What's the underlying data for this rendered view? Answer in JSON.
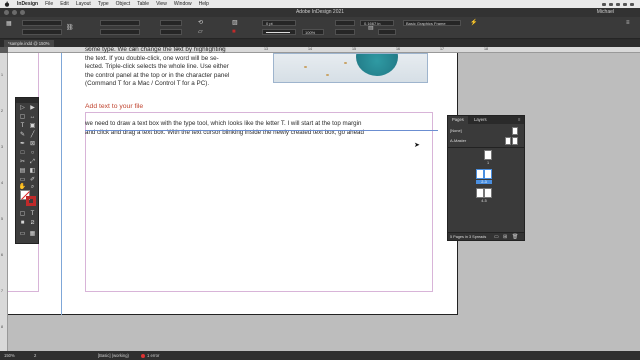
{
  "menubar": {
    "app": "InDesign",
    "items": [
      "File",
      "Edit",
      "Layout",
      "Type",
      "Object",
      "Table",
      "View",
      "Window",
      "Help"
    ]
  },
  "window": {
    "title": "Adobe InDesign 2021",
    "user": "Michael"
  },
  "control": {
    "font_size": "0 pt",
    "scale": "100%",
    "width_value": "0.1667 in",
    "style": "Basic Graphics Frame"
  },
  "document_tab": "*sample.indd @ 150%",
  "ruler": {
    "top_ticks": [
      "9",
      "10",
      "11",
      "12",
      "13",
      "14",
      "15",
      "16",
      "17",
      "18"
    ],
    "left_ticks": [
      "1",
      "2",
      "3",
      "4",
      "5",
      "6",
      "7",
      "8"
    ]
  },
  "document": {
    "body_lines": [
      "some type. We can change the text by highlighting",
      "the text. If you double-click,  one word will be se-",
      "lected. Triple-click selects the whole line. Use either",
      "the control panel at the top or in the character panel",
      "(Command T for a Mac / Control T for a PC)."
    ],
    "heading": "Add text to your file",
    "frame_lines": [
      "we need to draw a text box with the type tool, which looks like the letter T. I will start at the top margin",
      "and click and drag a text box. With the text cursor blinking inside the newly created text box, go ahead"
    ]
  },
  "pages_panel": {
    "tabs": [
      "Pages",
      "Layers"
    ],
    "none_label": "[None]",
    "master_label": "A-Master",
    "page_labels": [
      "1",
      "2-3",
      "4-5"
    ],
    "footer": "5 Pages in 3 Spreads",
    "colors": {
      "selection": "#4a8fe0"
    }
  },
  "status": {
    "zoom": "150%",
    "page": "2",
    "profile": "[Basic] (working)",
    "errors": "1 error"
  },
  "colors": {
    "heading": "#c0442f",
    "stroke_swatch": "#c02a2a",
    "guide": "#d8b4d8",
    "frame": "#6b8ed1"
  },
  "icons": [
    "apple-icon",
    "selection-tool-icon",
    "direct-selection-icon",
    "type-tool-icon",
    "pen-tool-icon",
    "pencil-tool-icon",
    "line-tool-icon",
    "rectangle-frame-icon",
    "rectangle-tool-icon",
    "scissors-icon",
    "free-transform-icon",
    "gradient-icon",
    "note-icon",
    "eyedropper-icon",
    "hand-tool-icon",
    "zoom-tool-icon",
    "fill-stroke-swatch",
    "screen-mode-icon",
    "mouse-cursor-icon"
  ]
}
